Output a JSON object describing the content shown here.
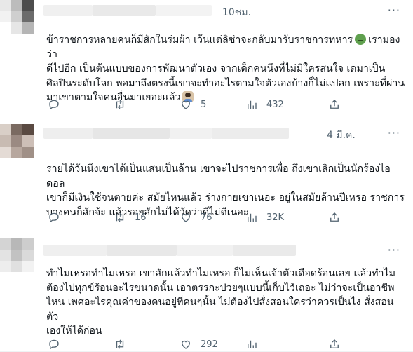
{
  "tweets": [
    {
      "time": "10ชม.",
      "more": "···",
      "lines": [
        "ข้าราชการหลายคนก็มีสักในร่มผ้า เว้นแต่ลิซ่าจะกลับมารับราชการทหาร",
        "เรามองว่า",
        "ดีไปอีก เป็นต้นแบบของการพัฒนาตัวเอง จากเด็กคนนึงที่ไม่มีใครสนใจ เดมาเป็น",
        "ศิลปินระดับโลก พอมาถึงตรงนี้เขาจะทำอะไรตามใจตัวเองบ้างก็ไม่แปลก เพราะที่ผ่าน",
        "มาเขาตามใจคนอื่นมาเยอะแล้ว"
      ],
      "emojis": [
        "nauseated-face",
        "person-shrugging"
      ],
      "counts": {
        "reply": "",
        "retweet": "",
        "like": "5",
        "views": "432"
      }
    },
    {
      "time": "4 มี.ค.",
      "more": "···",
      "lines": [
        "รายได้วันนึงเขาได้เป็นแสนเป็นล้าน เขาจะไปราชการเพื่อ ถึงเขาเลิกเป็นนักร้องไอดอล",
        "เขาก็มีเงินใช้จนตายค่ะ สมัยไหนแล้ว ร่างกายเขาเนอะ อยู่ในสมัยล้านปีเหรอ ราชการ",
        "บางคนก็สักจ้ะ แล้วรอยสักไม่ได้วัดว่าดีไม่ดีเนอะ"
      ],
      "counts": {
        "reply": "",
        "retweet": "16",
        "like": "76",
        "views": "32K"
      }
    },
    {
      "time": "",
      "more": "···",
      "lines": [
        "ทำไมเหรอทำไมเหรอ เขาสักแล้วทำไมเหรอ ก็ไม่เห็นเจ้าตัวเดือดร้อนเลย แล้วทำไม",
        "ต้องไปทุกข์ร้อนอะไรขนาดนั้น เอาตรรกะป่วยๆแบบนี้เก็บไว้เถอะ ไม่ว่าจะเป็นอาชีพ",
        "ไหน เพศอะไรคุณค่าของคนอยู่ที่คนๆนั้น ไม่ต้องไปสั่งสอนใครว่าควรเป็นไง สั่งสอนตัว",
        "เองให้ได้ก่อน"
      ],
      "counts": {
        "reply": "",
        "retweet": "",
        "like": "292",
        "views": ""
      }
    }
  ],
  "colors": {
    "text": "#0f1419",
    "secondary": "#536471",
    "divider": "#eff3f4"
  },
  "icons": [
    "reply-icon",
    "retweet-icon",
    "like-icon",
    "views-icon",
    "share-icon",
    "more-icon"
  ]
}
